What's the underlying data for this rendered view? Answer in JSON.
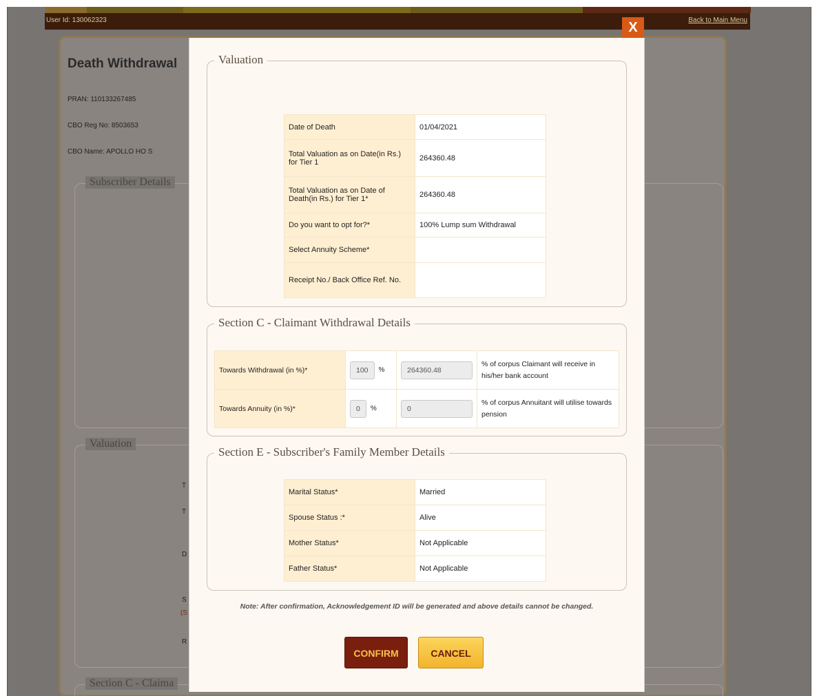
{
  "background": {
    "user_id": "User Id: 130062323",
    "back_link": "Back to Main Menu",
    "title": "Death Withdrawal",
    "pran": "PRAN:   110133267485",
    "cbo_reg": "CBO Reg No:   8503653",
    "cbo_name": "CBO Name:   APOLLO HO S",
    "section_subscriber": "Subscriber Details",
    "section_valuation": "Valuation",
    "section_c": "Section C - Claima",
    "frags": [
      "T",
      "T",
      "D",
      "S",
      "(S",
      "R"
    ]
  },
  "modal": {
    "close_label": "X",
    "valuation": {
      "legend": "Valuation",
      "rows": [
        {
          "label": "Date of Death",
          "value": "01/04/2021"
        },
        {
          "label": "Total Valuation as on Date(in Rs.) for Tier 1",
          "value": "264360.48"
        },
        {
          "label": "Total Valuation as on Date of Death(in Rs.) for Tier 1*",
          "value": "264360.48"
        },
        {
          "label": "Do you want to opt for?*",
          "value": "100% Lump sum Withdrawal"
        },
        {
          "label": "Select Annuity Scheme*",
          "value": ""
        },
        {
          "label": "Receipt No./ Back Office Ref. No.",
          "value": ""
        }
      ]
    },
    "section_c": {
      "legend": "Section C - Claimant Withdrawal Details",
      "rows": [
        {
          "label": "Towards Withdrawal (in %)*",
          "percent": "100",
          "pct_symbol": "%",
          "amount": "264360.48",
          "desc": "% of corpus Claimant will receive in his/her bank account"
        },
        {
          "label": "Towards Annuity (in %)*",
          "percent": "0",
          "pct_symbol": "%",
          "amount": "0",
          "desc": "% of corpus Annuitant will utilise towards pension"
        }
      ]
    },
    "section_e": {
      "legend": "Section E - Subscriber's Family Member Details",
      "rows": [
        {
          "label": "Marital Status*",
          "value": "Married"
        },
        {
          "label": "Spouse Status :*",
          "value": "Alive"
        },
        {
          "label": "Mother Status*",
          "value": "Not Applicable"
        },
        {
          "label": "Father Status*",
          "value": "Not Applicable"
        }
      ]
    },
    "note": "Note: After confirmation, Acknowledgement ID will be generated and above details cannot be changed.",
    "confirm_label": "CONFIRM",
    "cancel_label": "CANCEL"
  },
  "colors": {
    "close_button": "#d85a16",
    "confirm_button": "#7a1e0e",
    "cancel_button": "#f1b42b",
    "label_cell": "#ffefd2"
  }
}
